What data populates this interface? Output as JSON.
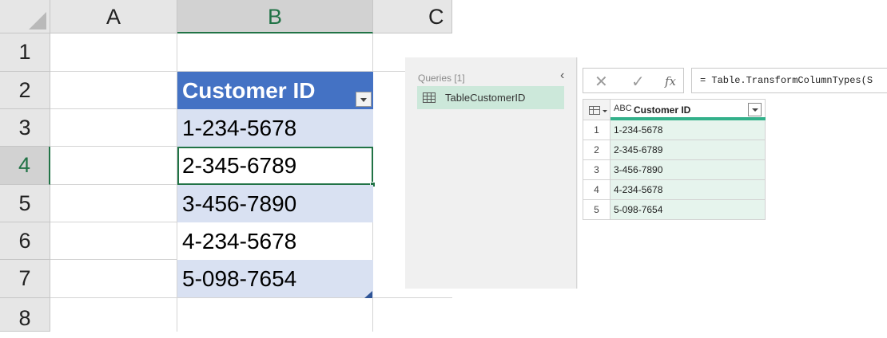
{
  "excel": {
    "columns": [
      "A",
      "B",
      "C"
    ],
    "rows": [
      "1",
      "2",
      "3",
      "4",
      "5",
      "6",
      "7",
      "8"
    ],
    "table_header": "Customer ID",
    "cells": [
      "1-234-5678",
      "2-345-6789",
      "3-456-7890",
      "4-234-5678",
      "5-098-7654"
    ],
    "colors": {
      "header_blue": "#4472c4",
      "band_blue": "#d9e1f2",
      "excel_green": "#217346"
    }
  },
  "power_query": {
    "queries_title": "Queries [1]",
    "collapse_glyph": "‹",
    "query_name": "TableCustomerID",
    "formula_buttons": {
      "cancel": "✕",
      "commit": "✓",
      "fx": "fx"
    },
    "formula": "= Table.TransformColumnTypes(S",
    "column_type_icon": "ABC",
    "column_name": "Customer ID",
    "row_numbers": [
      "1",
      "2",
      "3",
      "4",
      "5"
    ],
    "values": [
      "1-234-5678",
      "2-345-6789",
      "3-456-7890",
      "4-234-5678",
      "5-098-7654"
    ],
    "colors": {
      "accent_green": "#33b08a",
      "cell_green": "#e6f4ed",
      "selected_query": "#cce8da"
    }
  }
}
